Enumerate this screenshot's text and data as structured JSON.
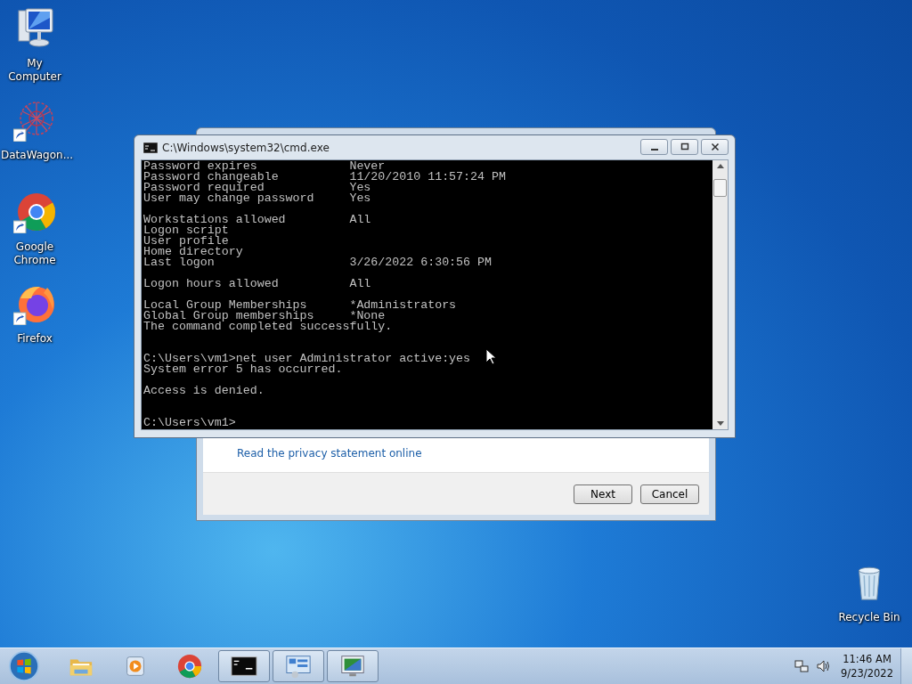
{
  "desktop_icons": [
    {
      "label": "My Computer",
      "kind": "computer",
      "shortcut": false
    },
    {
      "label": "DataWagon...",
      "kind": "network",
      "shortcut": true
    },
    {
      "label": "Google Chrome",
      "kind": "chrome",
      "shortcut": true
    },
    {
      "label": "Firefox",
      "kind": "firefox",
      "shortcut": true
    }
  ],
  "recycle_bin": {
    "label": "Recycle Bin"
  },
  "dialog": {
    "link": "Read the privacy statement online",
    "buttons": [
      "Next",
      "Cancel"
    ]
  },
  "console_window": {
    "title": "C:\\Windows\\system32\\cmd.exe",
    "blocks": [
      {
        "kind": "first",
        "lines": [
          "Password expires             Never",
          "Password changeable          11/20/2010 11:57:24 PM",
          "Password required            Yes",
          "User may change password     Yes"
        ]
      },
      {
        "kind": "after_blank",
        "lines": [
          "Workstations allowed         All",
          "Logon script",
          "User profile",
          "Home directory",
          "Last logon                   3/26/2022 6:30:56 PM"
        ]
      },
      {
        "kind": "after_blank",
        "lines": [
          "Logon hours allowed          All"
        ]
      },
      {
        "kind": "after_blank",
        "lines": [
          "Local Group Memberships      *Administrators",
          "Global Group memberships     *None",
          "The command completed successfully."
        ]
      },
      {
        "kind": "after_two_blanks",
        "lines": [
          "C:\\Users\\vm1>net user Administrator active:yes",
          "System error 5 has occurred."
        ]
      },
      {
        "kind": "after_blank",
        "lines": [
          "Access is denied."
        ]
      },
      {
        "kind": "after_two_blanks",
        "lines": [
          "C:\\Users\\vm1>"
        ]
      }
    ]
  },
  "taskbar": {
    "items": [
      {
        "kind": "folder",
        "running": false
      },
      {
        "kind": "media",
        "running": false
      },
      {
        "kind": "chrome",
        "running": false
      },
      {
        "kind": "console",
        "running": true
      },
      {
        "kind": "panel",
        "running": true
      },
      {
        "kind": "display",
        "running": true
      }
    ],
    "time": "11:46 AM",
    "date": "9/23/2022"
  }
}
